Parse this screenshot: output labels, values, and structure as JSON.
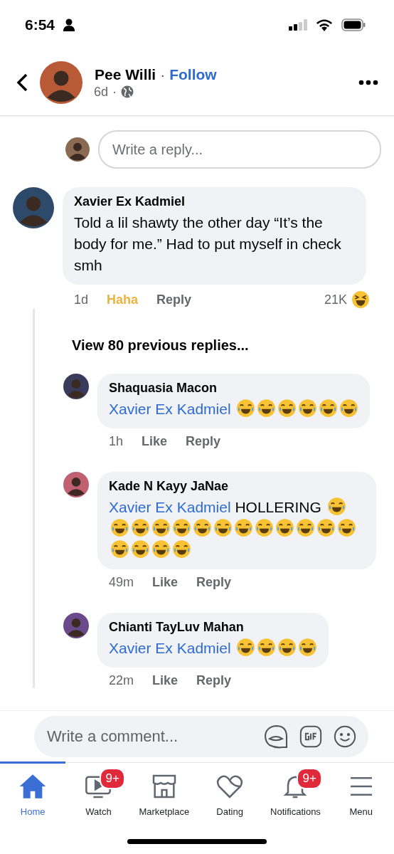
{
  "status_bar": {
    "time": "6:54"
  },
  "header": {
    "name": "Pee Willi",
    "separator": "·",
    "follow": "Follow",
    "age": "6d",
    "age_separator": "·"
  },
  "reply_box_top": {
    "placeholder": "Write a reply..."
  },
  "comment": {
    "author": "Xavier Ex Kadmiel",
    "text": "Told a lil shawty the other day “It’s the body for me.” Had to put myself in check smh",
    "time": "1d",
    "reaction": {
      "label": "Haha",
      "kind": "haha"
    },
    "reply": "Reply",
    "count": "21K"
  },
  "view_previous": "View 80 previous replies...",
  "replies": [
    {
      "author": "Shaquasia Macon",
      "mention": "Xavier Ex Kadmiel",
      "emojis": [
        {
          "kind": "laugh"
        },
        {
          "kind": "laugh"
        },
        {
          "kind": "laugh"
        },
        {
          "kind": "laugh"
        },
        {
          "kind": "laugh"
        },
        {
          "kind": "laugh"
        }
      ],
      "time": "1h",
      "like": "Like",
      "reply": "Reply"
    },
    {
      "author": "Kade N Kayy JaNae",
      "mention": "Xavier Ex Kadmiel",
      "text": "HOLLERING",
      "emojis": [
        {
          "kind": "laugh"
        },
        {
          "kind": "laugh"
        },
        {
          "kind": "laugh"
        },
        {
          "kind": "laugh"
        },
        {
          "kind": "laugh"
        },
        {
          "kind": "laugh"
        },
        {
          "kind": "laugh"
        },
        {
          "kind": "laugh"
        },
        {
          "kind": "laugh"
        },
        {
          "kind": "laugh"
        },
        {
          "kind": "laugh"
        },
        {
          "kind": "laugh"
        },
        {
          "kind": "laugh"
        },
        {
          "kind": "laugh"
        },
        {
          "kind": "laugh"
        },
        {
          "kind": "laugh"
        },
        {
          "kind": "laugh"
        }
      ],
      "time": "49m",
      "like": "Like",
      "reply": "Reply"
    },
    {
      "author": "Chianti TayLuv Mahan",
      "mention": "Xavier Ex Kadmiel",
      "emojis": [
        {
          "kind": "laugh"
        },
        {
          "kind": "laugh"
        },
        {
          "kind": "laugh"
        },
        {
          "kind": "laugh"
        }
      ],
      "time": "22m",
      "like": "Like",
      "reply": "Reply"
    }
  ],
  "comment_bar": {
    "placeholder": "Write a comment..."
  },
  "tabs": [
    {
      "label": "Home",
      "kind": "home",
      "selected": true
    },
    {
      "label": "Watch",
      "kind": "watch",
      "selected": false,
      "badge": "9+"
    },
    {
      "label": "Marketplace",
      "kind": "shop",
      "selected": false
    },
    {
      "label": "Dating",
      "kind": "heart",
      "selected": false
    },
    {
      "label": "Notifications",
      "kind": "bell",
      "selected": false,
      "badge": "9+"
    },
    {
      "label": "Menu",
      "kind": "menu",
      "selected": false
    }
  ]
}
